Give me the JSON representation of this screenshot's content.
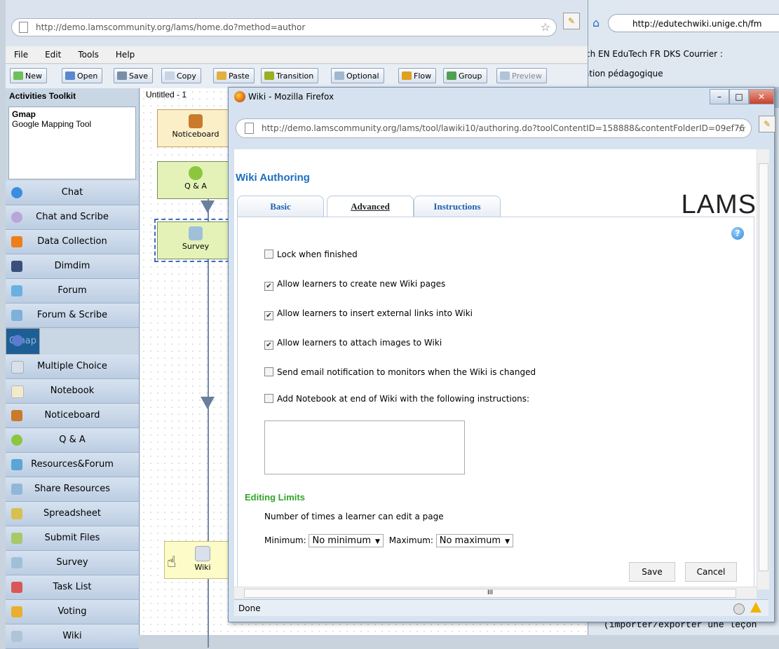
{
  "bg_window": {
    "url": "http://edutechwiki.unige.ch/fm",
    "bookmarks": "ch EN  EduTech FR  DKS  Courrier :",
    "subtitle": "ation pédagogique",
    "bottom_text": "(importer/exporter une leçon"
  },
  "main": {
    "url": "http://demo.lamscommunity.org/lams/home.do?method=author",
    "menu": [
      "File",
      "Edit",
      "Tools",
      "Help"
    ],
    "toolbar": {
      "new": "New",
      "open": "Open",
      "save": "Save",
      "copy": "Copy",
      "paste": "Paste",
      "transition": "Transition",
      "optional": "Optional",
      "flow": "Flow",
      "group": "Group",
      "preview": "Preview"
    },
    "toolkit": {
      "title": "Activities Toolkit",
      "desc_title": "Gmap",
      "desc_text": "Google Mapping Tool",
      "items": [
        {
          "label": "Chat",
          "color": "#3b8de0"
        },
        {
          "label": "Chat and Scribe",
          "color": "#b9a6d8"
        },
        {
          "label": "Data Collection",
          "color": "#ee7d1a"
        },
        {
          "label": "Dimdim",
          "color": "#3a4f7a"
        },
        {
          "label": "Forum",
          "color": "#6ab0e0"
        },
        {
          "label": "Forum & Scribe",
          "color": "#7fb0d8"
        },
        {
          "label": "Gmap",
          "color": "#5a7bd0"
        },
        {
          "label": "Multiple Choice",
          "color": "#d8e0ea"
        },
        {
          "label": "Notebook",
          "color": "#f2ead0"
        },
        {
          "label": "Noticeboard",
          "color": "#c97a2a"
        },
        {
          "label": "Q & A",
          "color": "#8cc63f"
        },
        {
          "label": "Resources&Forum",
          "color": "#5aa6d6"
        },
        {
          "label": "Share Resources",
          "color": "#8fb8d8"
        },
        {
          "label": "Spreadsheet",
          "color": "#d8c050"
        },
        {
          "label": "Submit Files",
          "color": "#a8c86a"
        },
        {
          "label": "Survey",
          "color": "#9fc0d8"
        },
        {
          "label": "Task List",
          "color": "#d85858"
        },
        {
          "label": "Voting",
          "color": "#e8b030"
        },
        {
          "label": "Wiki",
          "color": "#b0c4d8"
        }
      ],
      "selected": "Gmap"
    },
    "canvas": {
      "tab": "Untitled - 1",
      "activities": [
        "Noticeboard",
        "Q & A",
        "Survey",
        "Wiki"
      ]
    }
  },
  "popup": {
    "title": "Wiki - Mozilla Firefox",
    "url": "http://demo.lamscommunity.org/lams/tool/lawiki10/authoring.do?toolContentID=158888&contentFolderID=09ef76",
    "heading": "Wiki Authoring",
    "logo": "LAMS",
    "tabs": [
      "Basic",
      "Advanced",
      "Instructions"
    ],
    "active_tab": "Advanced",
    "options": [
      {
        "label": "Lock when finished",
        "checked": false
      },
      {
        "label": "Allow learners to create new Wiki pages",
        "checked": true
      },
      {
        "label": "Allow learners to insert external links into Wiki",
        "checked": true
      },
      {
        "label": "Allow learners to attach images to Wiki",
        "checked": true
      },
      {
        "label": "Send email notification to monitors when the Wiki is changed",
        "checked": false
      },
      {
        "label": "Add Notebook at end of Wiki with the following instructions:",
        "checked": false
      }
    ],
    "editing_limits_title": "Editing Limits",
    "editing_limits_label": "Number of times a learner can edit a page",
    "minimum_label": "Minimum:",
    "minimum_value": "No minimum",
    "maximum_label": "Maximum:",
    "maximum_value": "No maximum",
    "save": "Save",
    "cancel": "Cancel",
    "status": "Done",
    "hscroll_mark": "III"
  }
}
